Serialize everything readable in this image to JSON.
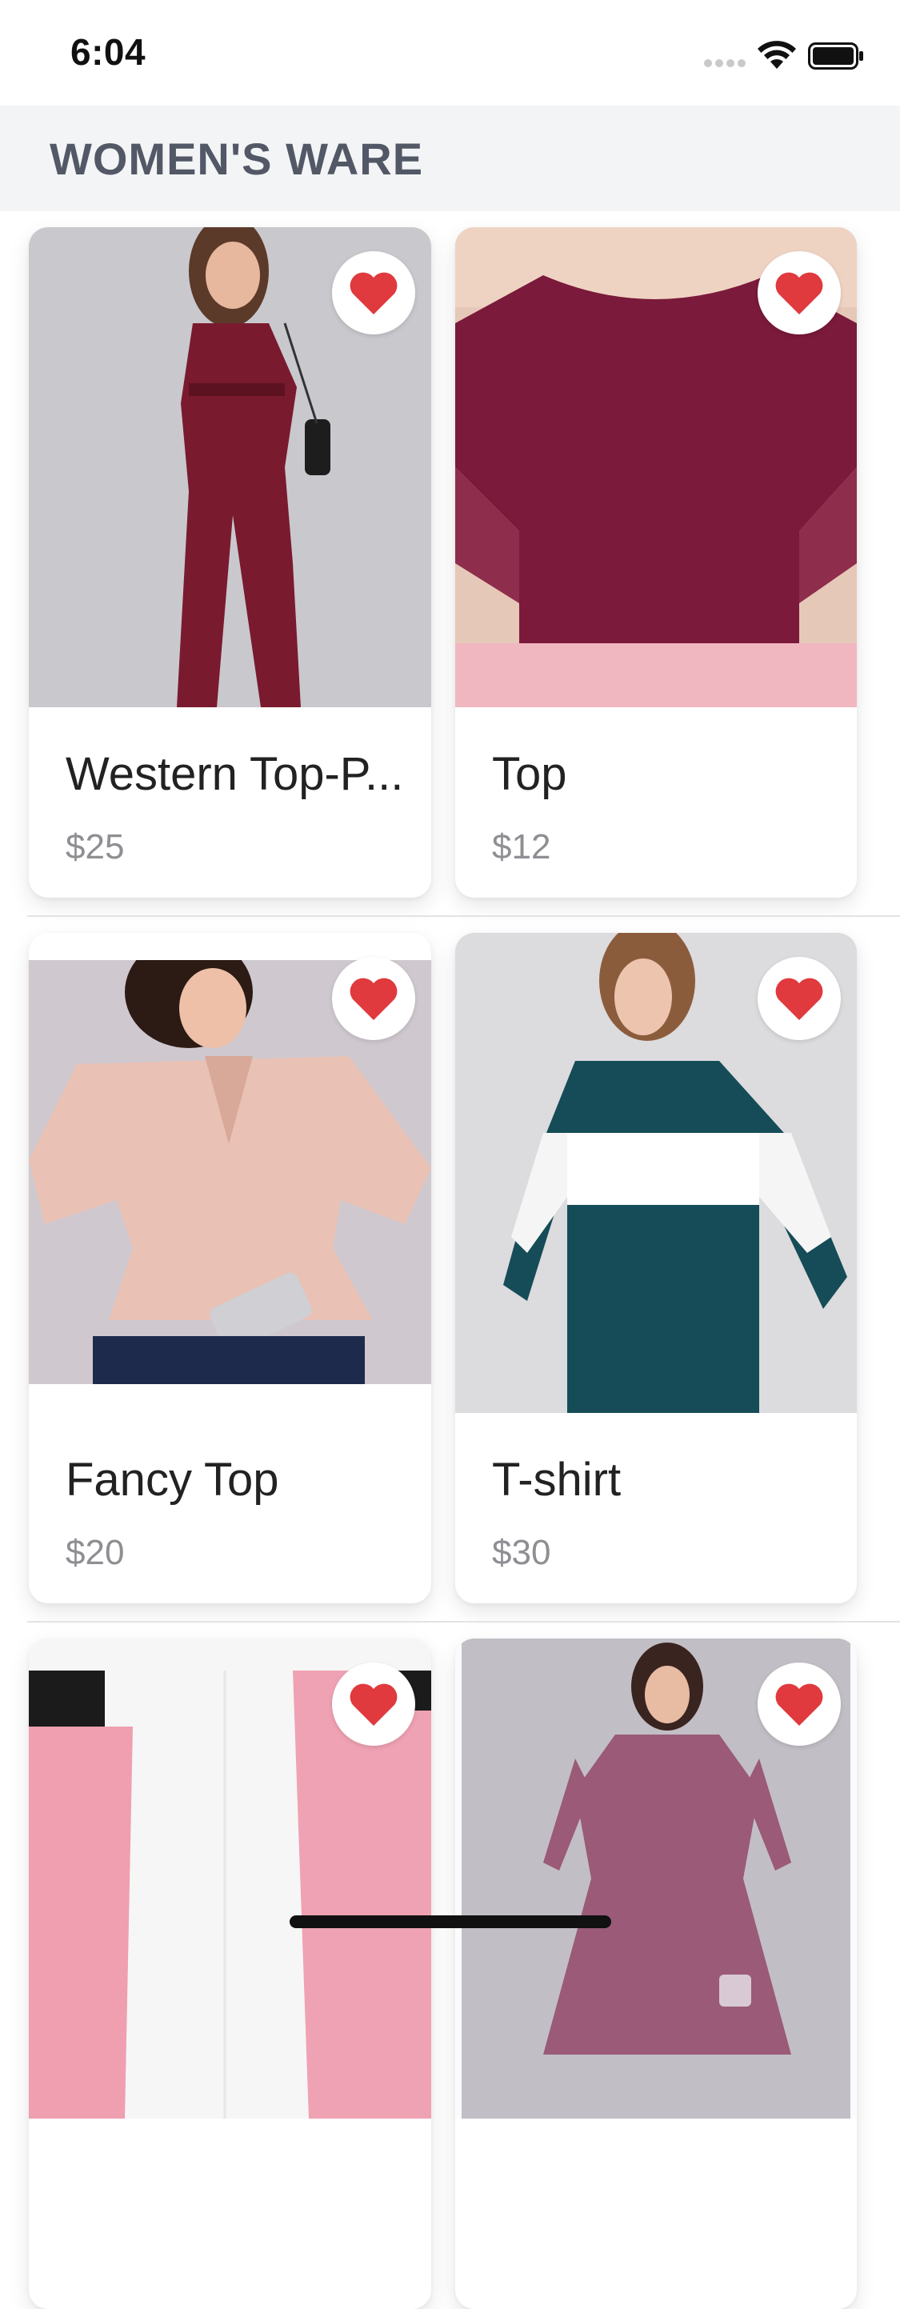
{
  "status_bar": {
    "time": "6:04"
  },
  "header": {
    "title": "WOMEN'S WARE"
  },
  "colors": {
    "heart": "#e0393e",
    "header_bg": "#f3f4f6",
    "title": "#535866",
    "price": "#8e8e93"
  },
  "products": [
    {
      "name": "Western Top-P...",
      "price": "$25",
      "favorite_icon": "heart-icon"
    },
    {
      "name": "Top",
      "price": "$12",
      "favorite_icon": "heart-icon"
    },
    {
      "name": "Fancy Top",
      "price": "$20",
      "favorite_icon": "heart-icon"
    },
    {
      "name": "T-shirt",
      "price": "$30",
      "favorite_icon": "heart-icon"
    },
    {
      "name": "",
      "price": "",
      "favorite_icon": "heart-icon"
    },
    {
      "name": "",
      "price": "",
      "favorite_icon": "heart-icon"
    }
  ]
}
